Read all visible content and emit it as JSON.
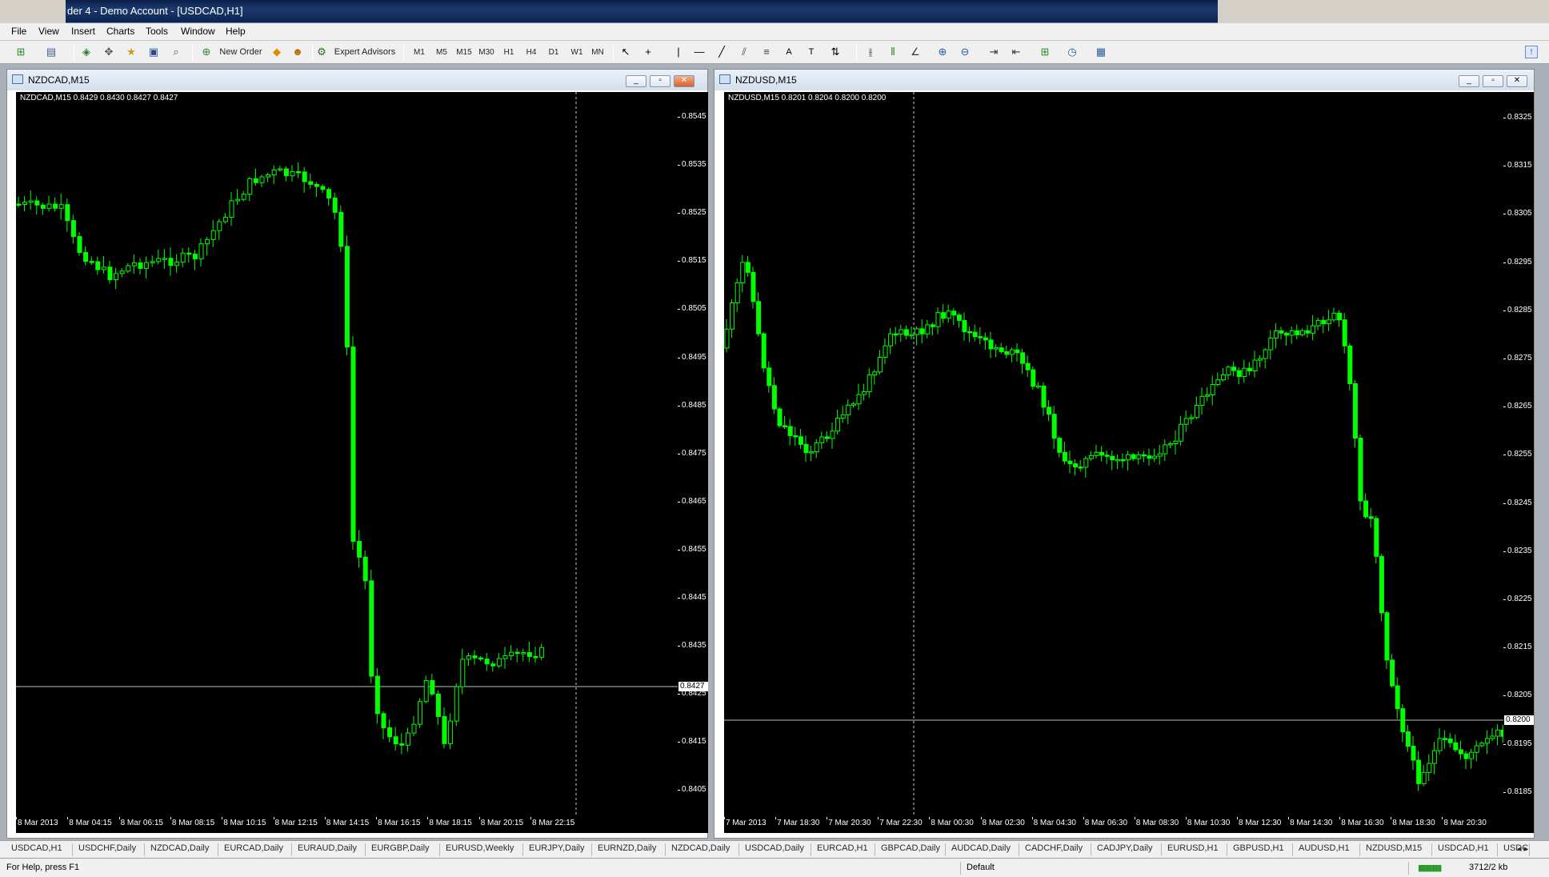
{
  "window_title": "der 4 - Demo Account - [USDCAD,H1]",
  "menu": [
    "File",
    "View",
    "Insert",
    "Charts",
    "Tools",
    "Window",
    "Help"
  ],
  "toolbar": {
    "new_order": "New Order",
    "expert_advisors": "Expert Advisors",
    "periods": [
      "M1",
      "M5",
      "M15",
      "M30",
      "H1",
      "H4",
      "D1",
      "W1",
      "MN"
    ]
  },
  "charts": [
    {
      "title": "NZDCAD,M15",
      "info": "NZDCAD,M15  0.8429 0.8430 0.8427 0.8427",
      "price_label": "0.8427",
      "y_ticks": [
        "0.8545",
        "0.8535",
        "0.8525",
        "0.8515",
        "0.8505",
        "0.8495",
        "0.8485",
        "0.8475",
        "0.8465",
        "0.8455",
        "0.8445",
        "0.8435",
        "0.8425",
        "0.8415",
        "0.8405"
      ],
      "x_ticks": [
        "8 Mar 2013",
        "8 Mar 04:15",
        "8 Mar 06:15",
        "8 Mar 08:15",
        "8 Mar 10:15",
        "8 Mar 12:15",
        "8 Mar 14:15",
        "8 Mar 16:15",
        "8 Mar 18:15",
        "8 Mar 20:15",
        "8 Mar 22:15"
      ]
    },
    {
      "title": "NZDUSD,M15",
      "info": "NZDUSD,M15  0.8201 0.8204 0.8200 0.8200",
      "price_label": "0.8200",
      "y_ticks": [
        "0.8325",
        "0.8315",
        "0.8305",
        "0.8295",
        "0.8285",
        "0.8275",
        "0.8265",
        "0.8255",
        "0.8245",
        "0.8235",
        "0.8225",
        "0.8215",
        "0.8205",
        "0.8195",
        "0.8185"
      ],
      "x_ticks": [
        "7 Mar 2013",
        "7 Mar 18:30",
        "7 Mar 20:30",
        "7 Mar 22:30",
        "8 Mar 00:30",
        "8 Mar 02:30",
        "8 Mar 04:30",
        "8 Mar 06:30",
        "8 Mar 08:30",
        "8 Mar 10:30",
        "8 Mar 12:30",
        "8 Mar 14:30",
        "8 Mar 16:30",
        "8 Mar 18:30",
        "8 Mar 20:30"
      ]
    }
  ],
  "tabs": [
    "USDCAD,H1",
    "USDCHF,Daily",
    "NZDCAD,Daily",
    "EURCAD,Daily",
    "EURAUD,Daily",
    "EURGBP,Daily",
    "EURUSD,Weekly",
    "EURJPY,Daily",
    "EURNZD,Daily",
    "NZDCAD,Daily",
    "USDCAD,Daily",
    "EURCAD,H1",
    "GBPCAD,Daily",
    "AUDCAD,Daily",
    "CADCHF,Daily",
    "CADJPY,Daily",
    "EURUSD,H1",
    "GBPUSD,H1",
    "AUDUSD,H1",
    "NZDUSD,M15",
    "USDCAD,H1",
    "USDC"
  ],
  "status": {
    "help": "For Help, press F1",
    "profile": "Default",
    "traffic": "3712/2 kb"
  },
  "colors": {
    "candle": "#00ff00",
    "background": "#000000",
    "price_line": "#c0c0c0"
  }
}
